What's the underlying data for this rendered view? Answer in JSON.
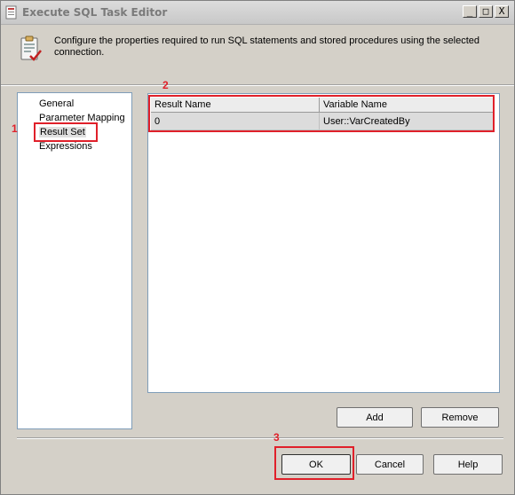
{
  "window": {
    "title": "Execute SQL Task Editor"
  },
  "caption_buttons": {
    "minimize": "_",
    "maximize": "□",
    "close": "X"
  },
  "header": {
    "description": "Configure the properties required to run SQL statements and stored procedures using the selected connection."
  },
  "nav": {
    "items": [
      {
        "label": "General"
      },
      {
        "label": "Parameter Mapping"
      },
      {
        "label": "Result Set"
      },
      {
        "label": "Expressions"
      }
    ],
    "selected": "Result Set"
  },
  "grid": {
    "columns": [
      "Result Name",
      "Variable Name"
    ],
    "rows": [
      {
        "result_name": "0",
        "variable_name": "User::VarCreatedBy"
      }
    ]
  },
  "buttons": {
    "add": "Add",
    "remove": "Remove",
    "ok": "OK",
    "cancel": "Cancel",
    "help": "Help"
  },
  "annotations": {
    "n1": "1",
    "n2": "2",
    "n3": "3"
  },
  "colors": {
    "highlight": "#e0202a",
    "window_bg": "#d4d0c8",
    "panel_border": "#7f9db9"
  }
}
